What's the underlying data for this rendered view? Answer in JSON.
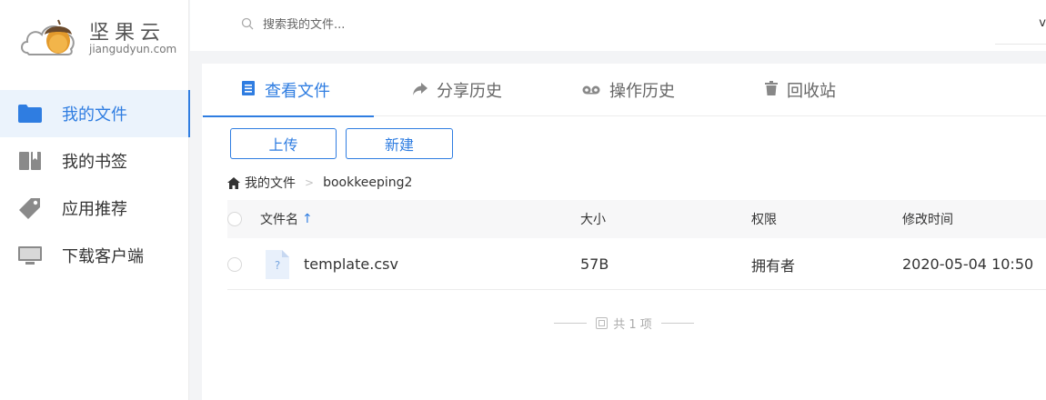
{
  "brand": {
    "name_cn": "坚果云",
    "domain": "jiangudyun.com"
  },
  "sidebar": {
    "items": [
      {
        "label": "我的文件",
        "icon": "folder-icon",
        "active": true
      },
      {
        "label": "我的书签",
        "icon": "bookmark-icon",
        "active": false
      },
      {
        "label": "应用推荐",
        "icon": "tag-icon",
        "active": false
      },
      {
        "label": "下载客户端",
        "icon": "monitor-icon",
        "active": false
      }
    ]
  },
  "search": {
    "placeholder": "搜索我的文件...",
    "value": "",
    "icon": "search-icon"
  },
  "topbar": {
    "right_mark": "v"
  },
  "tabs": [
    {
      "label": "查看文件",
      "icon": "document-icon",
      "active": true
    },
    {
      "label": "分享历史",
      "icon": "share-icon",
      "active": false
    },
    {
      "label": "操作历史",
      "icon": "history-icon",
      "active": false
    },
    {
      "label": "回收站",
      "icon": "trash-icon",
      "active": false
    }
  ],
  "toolbar": {
    "upload_label": "上传",
    "new_label": "新建"
  },
  "breadcrumb": {
    "items": [
      "我的文件",
      "bookkeeping2"
    ],
    "separator": ">"
  },
  "table": {
    "headers": {
      "name": "文件名",
      "name_sort": "↑",
      "size": "大小",
      "permission": "权限",
      "modified": "修改时间"
    },
    "rows": [
      {
        "name": "template.csv",
        "type_mark": "?",
        "size": "57B",
        "permission": "拥有者",
        "modified": "2020-05-04 10:50"
      }
    ]
  },
  "footer": {
    "count_text": "共 1 项"
  },
  "colors": {
    "accent": "#2f7de1",
    "sidebar_active_bg": "#ebf3fc",
    "icon_gray": "#8a8a8a"
  }
}
